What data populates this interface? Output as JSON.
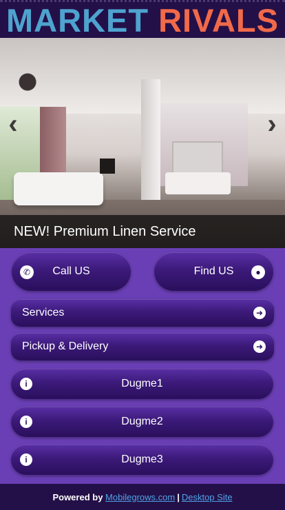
{
  "header": {
    "logo_word1": "MARKET",
    "logo_word2": "RIVALS",
    "colors": {
      "word1": "#4ea3cf",
      "word2": "#f06a4a",
      "bar": "#241048"
    }
  },
  "slider": {
    "caption": "NEW! Premium Linen Service",
    "prev_icon": "chevron-left-icon",
    "next_icon": "chevron-right-icon"
  },
  "actions": {
    "call_label": "Call US",
    "find_label": "Find US"
  },
  "menu": {
    "services_label": "Services",
    "pickup_label": "Pickup & Delivery"
  },
  "links": [
    {
      "label": "Dugme1",
      "icon": "info-icon"
    },
    {
      "label": "Dugme2",
      "icon": "info-icon"
    },
    {
      "label": "Dugme3",
      "icon": "info-icon"
    }
  ],
  "footer": {
    "powered_by": "Powered by",
    "provider_link": "Mobilegrows.com",
    "separator": "|",
    "desktop_link": " Desktop Site"
  },
  "colors": {
    "background": "#6a3fb5",
    "button": "#3c1a7a",
    "link": "#4ea3e8"
  }
}
